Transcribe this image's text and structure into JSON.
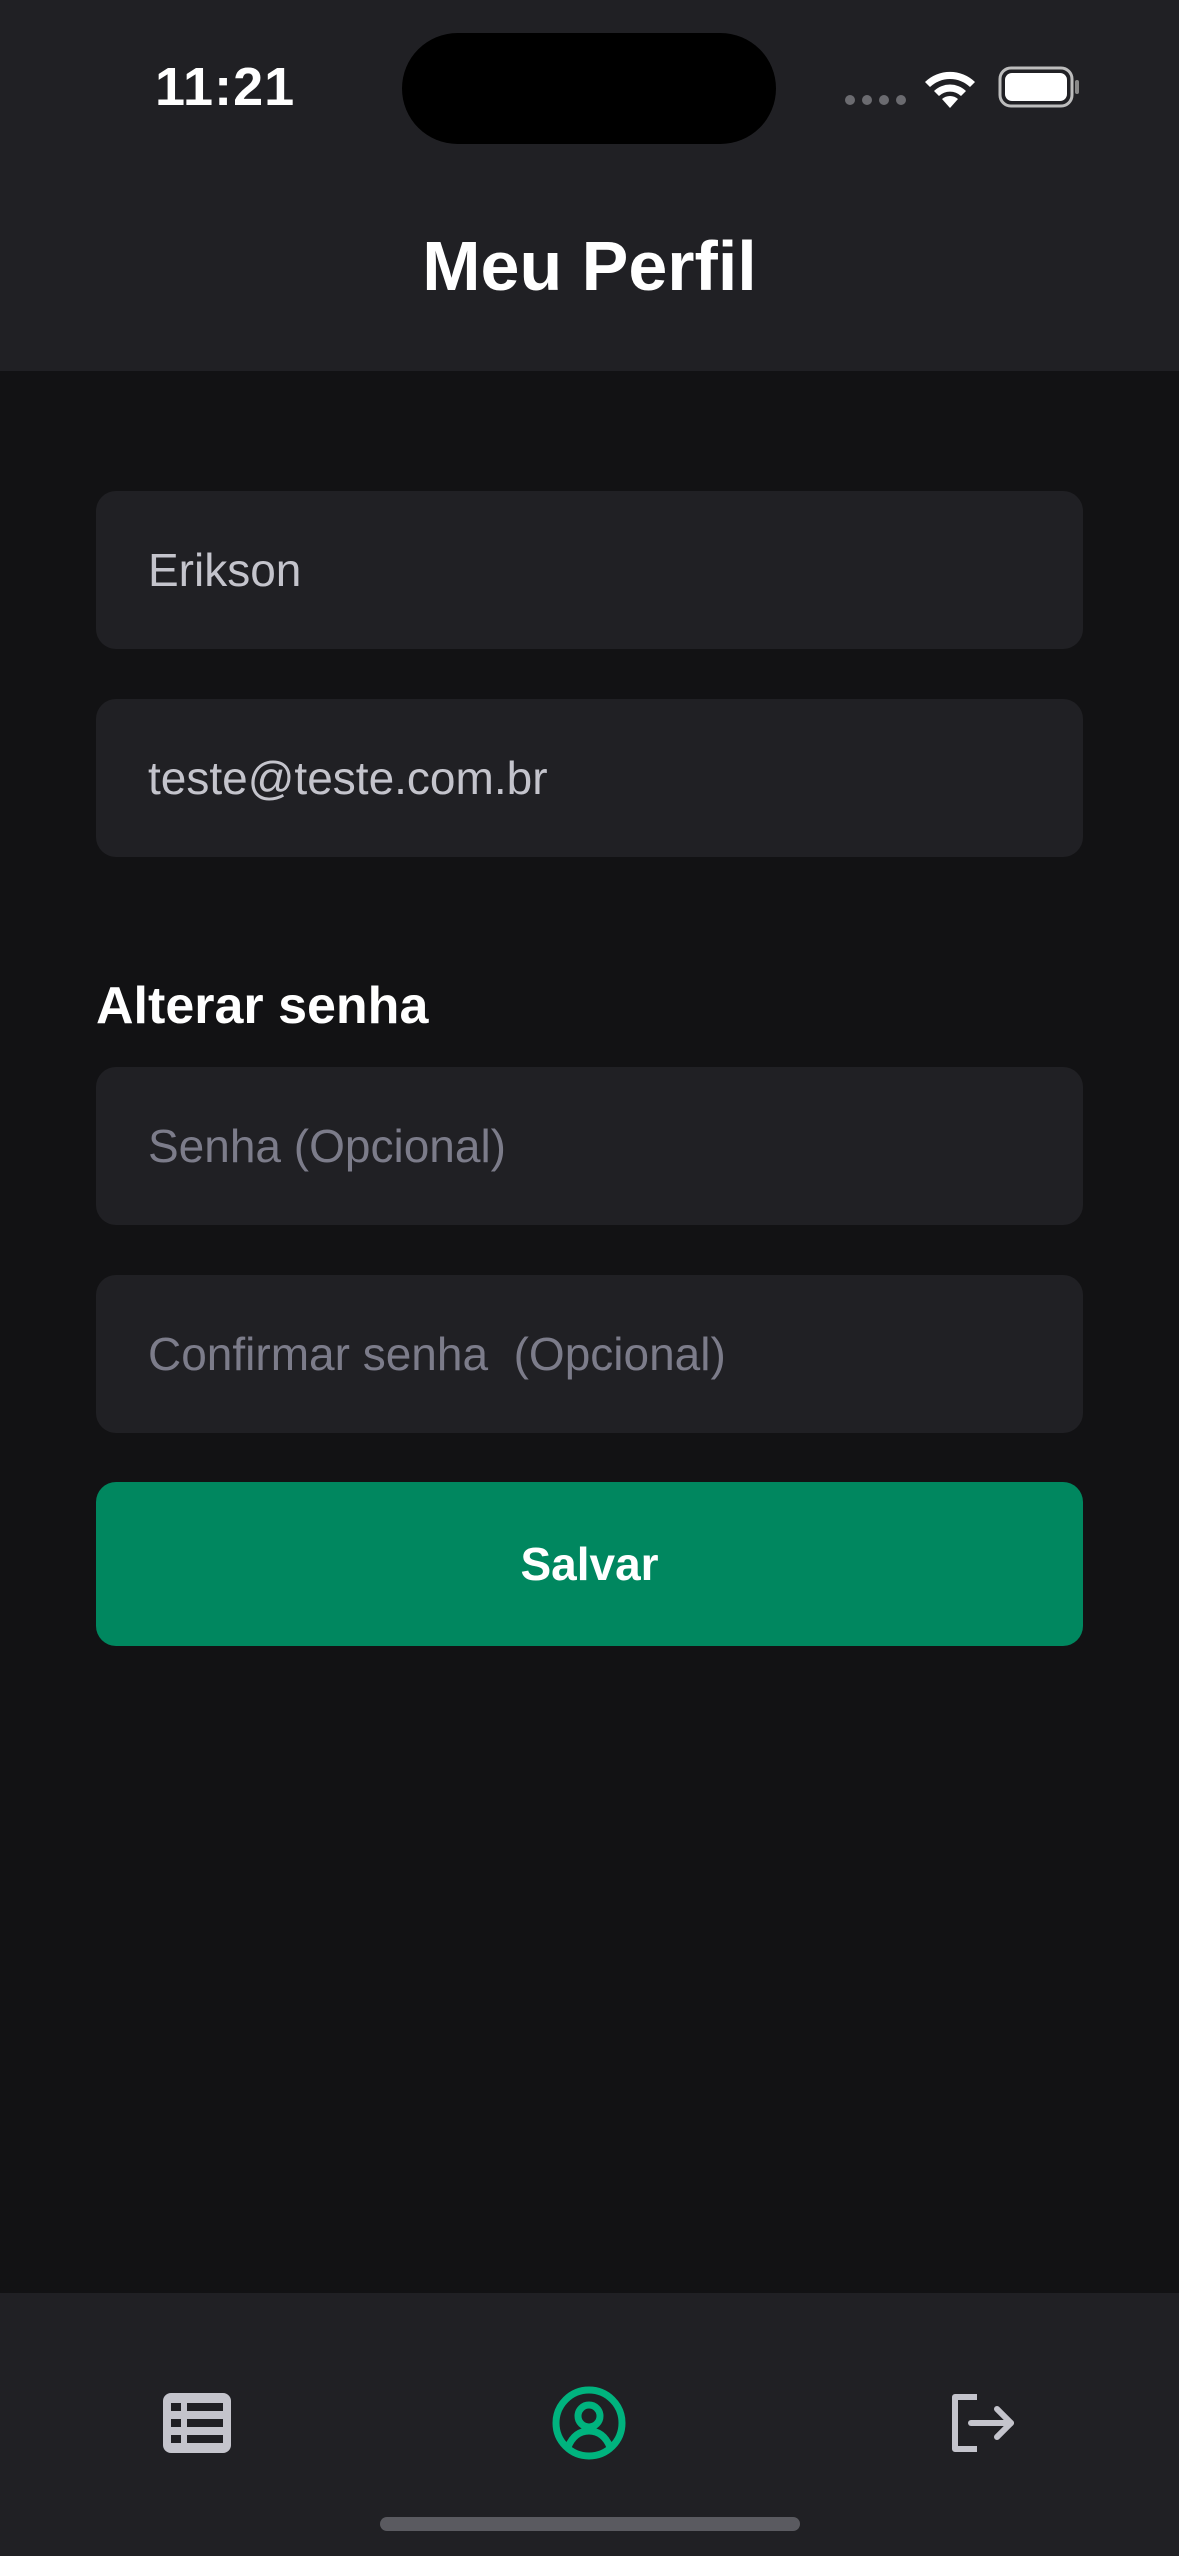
{
  "status_bar": {
    "time": "11:21"
  },
  "header": {
    "title": "Meu Perfil"
  },
  "form": {
    "name_value": "Erikson",
    "email_value": "teste@teste.com.br",
    "password_section_label": "Alterar senha",
    "password_placeholder": "Senha (Opcional)",
    "confirm_password_placeholder": "Confirmar senha  (Opcional)",
    "save_label": "Salvar"
  },
  "tabbar": {
    "items": [
      {
        "icon": "list-icon",
        "active": false
      },
      {
        "icon": "user-circle-icon",
        "active": true
      },
      {
        "icon": "logout-icon",
        "active": false
      }
    ]
  },
  "colors": {
    "background": "#121214",
    "surface": "#202024",
    "accent": "#00875f",
    "active_icon": "#00b37e",
    "inactive_icon": "#c4c4cc"
  }
}
